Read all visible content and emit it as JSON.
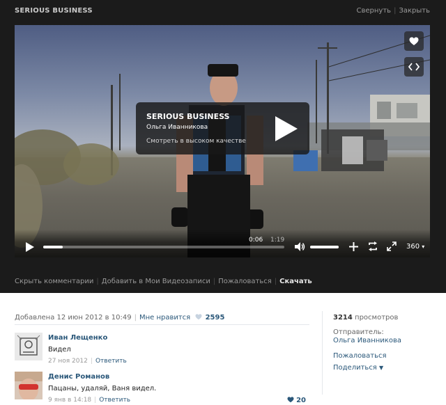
{
  "window": {
    "title": "SERIOUS BUSINESS",
    "minimize_label": "Свернуть",
    "close_label": "Закрыть"
  },
  "player": {
    "card_title": "SERIOUS BUSINESS",
    "card_author": "Ольга Иванникова",
    "hq_link": "Смотреть в высоком качестве",
    "current_time": "0:06",
    "total_time": "1:19",
    "progress_percent": 8,
    "volume_percent": 100,
    "quality": "360"
  },
  "actions": {
    "hide_comments": "Скрыть комментарии",
    "add_to_videos": "Добавить в Мои Видеозаписи",
    "report": "Пожаловаться",
    "download": "Скачать"
  },
  "info": {
    "added": "Добавлена 12 июн 2012 в 10:49",
    "like_label": "Мне нравится",
    "likes": "2595"
  },
  "comments": [
    {
      "author": "Иван Лещенко",
      "text": "Видел",
      "date": "27 ноя 2012",
      "reply": "Ответить",
      "likes": ""
    },
    {
      "author": "Денис Романов",
      "text": "Пацаны, удаляй, Ваня видел.",
      "date": "9 янв в 14:18",
      "reply": "Ответить",
      "likes": "20"
    }
  ],
  "sidebar": {
    "views_count": "3214",
    "views_label": "просмотров",
    "sender_label": "Отправитель:",
    "sender_name": "Ольга Иванникова",
    "report_label": "Пожаловаться",
    "share_label": "Поделиться"
  },
  "colors": {
    "dark_bg": "#1b1b1b",
    "link": "#2b587a",
    "muted": "#999999"
  }
}
